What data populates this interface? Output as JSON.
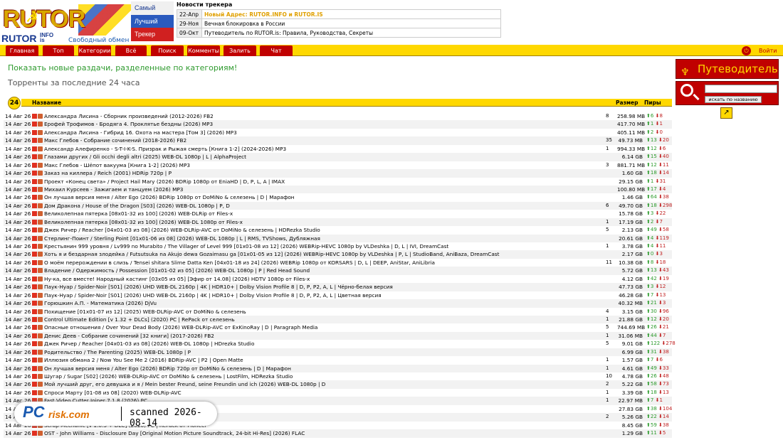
{
  "logo": {
    "name": "RUTOR",
    "small": "RUTOR",
    "tld_info": "INFO",
    "tld_is": "is",
    "slogan": "Свободный обмен",
    "flag_lines": [
      "Самый",
      "Лучший",
      "Трекер"
    ]
  },
  "news": {
    "title": "Новости трекера",
    "items": [
      {
        "date": "22-Апр",
        "text": "Новый Адрес: RUTOR.INFO и RUTOR.IS",
        "highlight": true
      },
      {
        "date": "29-Ноя",
        "text": "Вечная блокировка в России",
        "highlight": false
      },
      {
        "date": "09-Окт",
        "text": "Путеводитель по RUTOR.is: Правила, Руководства, Секреты",
        "highlight": false
      }
    ]
  },
  "menu": {
    "items": [
      "Главная",
      "Топ",
      "Категории",
      "Всё",
      "Поиск",
      "Комменты",
      "Залить",
      "Чат"
    ],
    "login": "Войти"
  },
  "main": {
    "new_by_category": "Показать новые раздачи, разделенные по категориям!",
    "last24": "Торренты за последние 24 часа",
    "badge": "24",
    "headers": {
      "name": "Название",
      "size": "Размер",
      "peers": "Пиры"
    }
  },
  "sidebar": {
    "guide": "Путеводитель",
    "search_button": "искать по названию",
    "arrow": "↗"
  },
  "watermark": {
    "pc": "PC",
    "risk": "risk.com",
    "scanned": "scanned 2026-08-14"
  },
  "torrents": [
    {
      "date": "14 Авг 26",
      "title": "Александра Лисина - Сборник произведений (2012-2026) FB2",
      "com": "8",
      "size": "258.98 MB",
      "up": "6",
      "down": "8"
    },
    {
      "date": "14 Авг 26",
      "title": "Ерофей Трофимов - Бродяга 4. Проклятье бездны (2026) MP3",
      "com": "",
      "size": "417.70 MB",
      "up": "1",
      "down": "1"
    },
    {
      "date": "14 Авг 26",
      "title": "Александра Лисина - Гибрид 16. Охота на мастера [Том 3] (2026) MP3",
      "com": "",
      "size": "405.11 MB",
      "up": "2",
      "down": "0"
    },
    {
      "date": "14 Авг 26",
      "title": "Макс Глебов - Собрание сочинений (2018-2026) FB2",
      "com": "35",
      "size": "49.73 MB",
      "up": "13",
      "down": "20"
    },
    {
      "date": "14 Авг 26",
      "title": "Александр Алефиренко - S-T-I-K-S. Призрак и Рыжая смерть [Книга 1-2] (2024-2026) MP3",
      "com": "1",
      "size": "994.33 MB",
      "up": "12",
      "down": "6"
    },
    {
      "date": "14 Авг 26",
      "title": "Глазами других / Gli occhi degli altri (2025) WEB-DL 1080p | L | AlphaProject",
      "com": "",
      "size": "6.14 GB",
      "up": "15",
      "down": "40"
    },
    {
      "date": "14 Авг 26",
      "title": "Макс Глебов - Шёпот вакуума [Книга 1-2] (2026) MP3",
      "com": "3",
      "size": "881.71 MB",
      "up": "12",
      "down": "11"
    },
    {
      "date": "14 Авг 26",
      "title": "Заказ на киллера / Reich (2001) HDRip 720p | P",
      "com": "",
      "size": "1.60 GB",
      "up": "18",
      "down": "14"
    },
    {
      "date": "14 Авг 26",
      "title": "Проект «Конец света» / Project Hail Mary (2026) BDRip 1080p от EniaHD | D, P, L, A | IMAX",
      "com": "",
      "size": "29.15 GB",
      "up": "1",
      "down": "31"
    },
    {
      "date": "14 Авг 26",
      "title": "Михаил Курсеев - Зажигаем и танцуем (2026) MP3",
      "com": "",
      "size": "100.80 MB",
      "up": "17",
      "down": "4"
    },
    {
      "date": "14 Авг 26",
      "title": "Он лучшая версия меня / Alter Ego (2026) BDRip 1080p от DoMiNo & селезень | D | Марафон",
      "com": "",
      "size": "1.46 GB",
      "up": "64",
      "down": "38"
    },
    {
      "date": "14 Авг 26",
      "title": "Дом Дракона / House of the Dragon [S03] (2026) WEB-DL 1080p | P, D",
      "com": "6",
      "size": "49.70 GB",
      "up": "18",
      "down": "298"
    },
    {
      "date": "14 Авг 26",
      "title": "Великолепная пятерка [08x01-32 из 100] (2026) WEB-DLRip от Files-x",
      "com": "",
      "size": "15.78 GB",
      "up": "3",
      "down": "22"
    },
    {
      "date": "14 Авг 26",
      "title": "Великолепная пятерка [08x01-32 из 100] (2026) WEB-DL 1080p от Files-x",
      "com": "1",
      "size": "17.19 GB",
      "up": "2",
      "down": "7"
    },
    {
      "date": "14 Авг 26",
      "title": "Джек Ричер / Reacher [04x01-03 из 08] (2026) WEB-DLRip-AVC от DoMiNo & селезень | HDRezka Studio",
      "com": "5",
      "size": "2.13 GB",
      "up": "49",
      "down": "58"
    },
    {
      "date": "14 Авг 26",
      "title": "Стерлинг-Поинт / Sterling Point [01x01-06 из 08] (2026) WEB-DL 1080p | L | RMS, TVShows, Дубляжная",
      "com": "",
      "size": "20.61 GB",
      "up": "4",
      "down": "119"
    },
    {
      "date": "14 Авг 26",
      "title": "Крестьянин 999 уровня / Lv999 no Murabito / The Villager of Level 999 [01x01-08 из 12] (2026) WEBRip-HEVC 1080p by VLDeshka | D, L | IVI, DreamCast",
      "com": "1",
      "size": "3.78 GB",
      "up": "4",
      "down": "11"
    },
    {
      "date": "14 Авг 26",
      "title": "Хоть я и бездарная злодейка / Futsutsuka na Akujo dewa Gozaimasu ga [01x01-05 из 12] (2026) WEBRip-HEVC 1080p by VLDeshka | P, L | StudioBand, AniBaza, DreamCast",
      "com": "",
      "size": "2.17 GB",
      "up": "0",
      "down": "3"
    },
    {
      "date": "14 Авг 26",
      "title": "О моём перерождении в слизь / Tensei shitara Slime Datta Ken [04x01-18 из 24] (2026) WEBRip 1080p от KORSARS | D, L | DEEP, AniStar, AniLibria",
      "com": "11",
      "size": "10.38 GB",
      "up": "8",
      "down": "18"
    },
    {
      "date": "14 Авг 26",
      "title": "Владение / Одержимость / Possession [01x01-02 из 05] (2026) WEB-DL 1080p | P | Red Head Sound",
      "com": "",
      "size": "5.72 GB",
      "up": "13",
      "down": "43"
    },
    {
      "date": "14 Авг 26",
      "title": "Ну-ка, все вместе! Народный кастинг [03x05 из 05] [Эфир от 14.08] (2026) HDTV 1080p от Files-x",
      "com": "",
      "size": "4.12 GB",
      "up": "42",
      "down": "19"
    },
    {
      "date": "14 Авг 26",
      "title": "Паук-Нуар / Spider-Noir [S01] (2026) UHD WEB-DL 2160p | 4K | HDR10+ | Dolby Vision Profile 8 | D, P, P2, A, L | Чёрно-белая версия",
      "com": "",
      "size": "47.73 GB",
      "up": "3",
      "down": "12"
    },
    {
      "date": "14 Авг 26",
      "title": "Паук-Нуар / Spider-Noir [S01] (2026) UHD WEB-DL 2160p | 4K | HDR10+ | Dolby Vision Profile 8 | D, P, P2, A, L | Цветная версия",
      "com": "",
      "size": "46.28 GB",
      "up": "7",
      "down": "13"
    },
    {
      "date": "14 Авг 26",
      "title": "Горюшкин А.П. - Математика (2026) DjVu",
      "com": "",
      "size": "40.32 MB",
      "up": "21",
      "down": "3"
    },
    {
      "date": "14 Авг 26",
      "title": "Похищение [01x01-07 из 12] (2025) WEB-DLRip-AVC от DoMiNo & селезень",
      "com": "4",
      "size": "3.15 GB",
      "up": "30",
      "down": "96"
    },
    {
      "date": "14 Авг 26",
      "title": "Control Ultimate Edition [v 1.32 + DLCs] (2020) PC | RePack от селезень",
      "com": "1",
      "size": "21.88 GB",
      "up": "12",
      "down": "20"
    },
    {
      "date": "14 Авг 26",
      "title": "Опасные отношения / Over Your Dead Body (2026) WEB-DLRip-AVC от ExKinoRay | D | Paragraph Media",
      "com": "5",
      "size": "744.69 MB",
      "up": "26",
      "down": "21"
    },
    {
      "date": "14 Авг 26",
      "title": "Денис Деев - Собрание сочинений [32 книги] (2017-2026) FB2",
      "com": "1",
      "size": "31.06 MB",
      "up": "44",
      "down": "7"
    },
    {
      "date": "14 Авг 26",
      "title": "Джек Ричер / Reacher [04x01-03 из 08] (2026) WEB-DL 1080p | HDrezka Studio",
      "com": "5",
      "size": "9.01 GB",
      "up": "122",
      "down": "278"
    },
    {
      "date": "14 Авг 26",
      "title": "Родительство / The Parenting (2025) WEB-DL 1080p | P",
      "com": "",
      "size": "6.99 GB",
      "up": "31",
      "down": "38"
    },
    {
      "date": "14 Авг 26",
      "title": "Иллюзия обмана 2 / Now You See Me 2 (2016) BDRip-AVC | P2 | Open Matte",
      "com": "1",
      "size": "1.57 GB",
      "up": "7",
      "down": "6"
    },
    {
      "date": "14 Авг 26",
      "title": "Он лучшая версия меня / Alter Ego (2026) BDRip 720p от DoMiNo & селезень | D | Марафон",
      "com": "1",
      "size": "4.61 GB",
      "up": "49",
      "down": "33"
    },
    {
      "date": "14 Авг 26",
      "title": "Шугар / Sugar [S02] (2026) WEB-DLRip-AVC от DoMiNo & селезень | LostFilm, HDRezka Studio",
      "com": "10",
      "size": "4.78 GB",
      "up": "26",
      "down": "48"
    },
    {
      "date": "14 Авг 26",
      "title": "Мой лучший друг, его девушка и я / Mein bester Freund, seine Freundin und ich (2026) WEB-DL 1080p | D",
      "com": "2",
      "size": "5.22 GB",
      "up": "58",
      "down": "73"
    },
    {
      "date": "14 Авг 26",
      "title": "Спроси Марту [01-08 из 08] (2020) WEB-DLRip-AVC",
      "com": "1",
      "size": "3.39 GB",
      "up": "18",
      "down": "13"
    },
    {
      "date": "14 Авг 26",
      "title": "Fast Video Cutter Joiner 7.1.8 (2026) PC",
      "com": "1",
      "size": "22.97 MB",
      "up": "7",
      "down": "1"
    },
    {
      "date": "14 Авг 26",
      "title": "började onanera (2022) BDRip 720p от msltel | L1",
      "com": "",
      "size": "27.83 GB",
      "up": "38",
      "down": "104"
    },
    {
      "date": "14 Авг 26",
      "title": "började onanera (2022) BDRip 720p от msltel | L1",
      "com": "2",
      "size": "5.26 GB",
      "up": "22",
      "down": "14"
    },
    {
      "date": "14 Авг 26",
      "title": "Scrap Mechanic [v 1.0.3 + DLC] (2020) PC | RePack от Pioneer",
      "com": "",
      "size": "8.45 GB",
      "up": "59",
      "down": "38"
    },
    {
      "date": "14 Авг 26",
      "title": "OST - John Williams - Disclosure Day [Original Motion Picture Soundtrack, 24-bit Hi-Res] (2026) FLAC",
      "com": "",
      "size": "1.29 GB",
      "up": "11",
      "down": "5"
    }
  ]
}
